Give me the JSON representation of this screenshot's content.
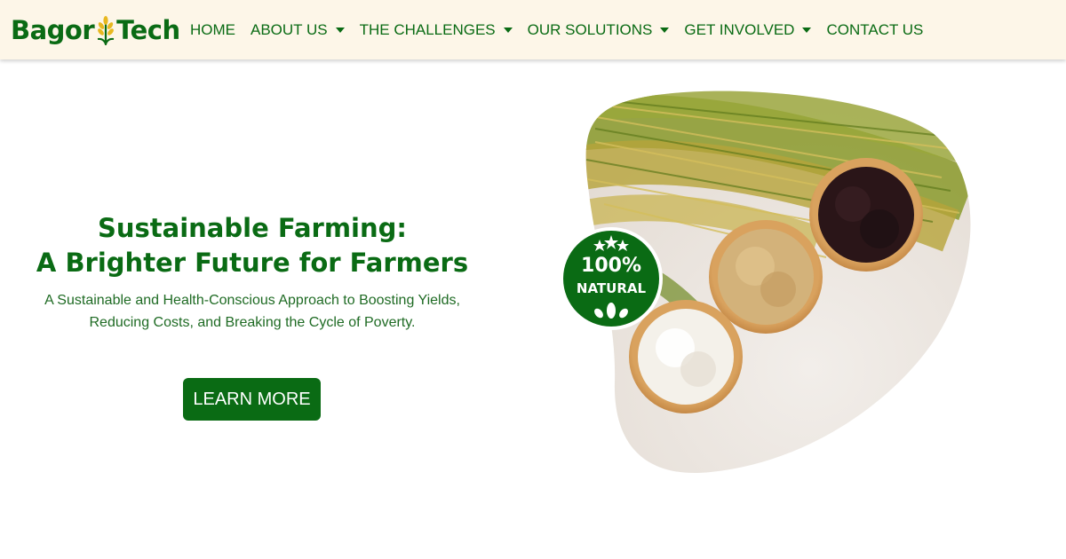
{
  "brand": {
    "name_left": "Bagor",
    "name_right": "Tech"
  },
  "nav": {
    "items": [
      {
        "label": "HOME",
        "dropdown": false
      },
      {
        "label": "ABOUT US",
        "dropdown": true
      },
      {
        "label": "THE CHALLENGES",
        "dropdown": true
      },
      {
        "label": "OUR SOLUTIONS",
        "dropdown": true
      },
      {
        "label": "GET INVOLVED",
        "dropdown": true
      },
      {
        "label": "CONTACT US",
        "dropdown": false
      }
    ]
  },
  "hero": {
    "title_line1": "Sustainable Farming:",
    "title_line2": "A Brighter Future for Farmers",
    "subtitle_line1": "A Sustainable and Health-Conscious Approach to Boosting Yields,",
    "subtitle_line2": "Reducing Costs, and Breaking the Cycle of Poverty.",
    "cta_label": "LEARN MORE"
  },
  "badge": {
    "top": "100%",
    "bottom": "NATURAL"
  },
  "colors": {
    "brand_green": "#0a6b14",
    "nav_background": "#fdf6e8",
    "button_text": "#ffffff"
  }
}
